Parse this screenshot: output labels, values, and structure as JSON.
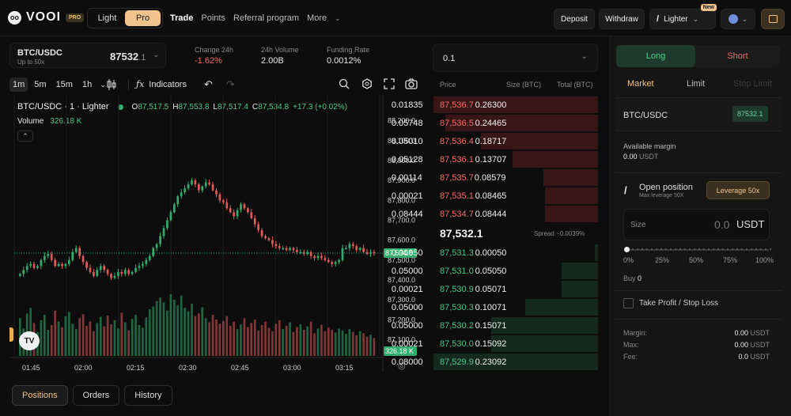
{
  "app": {
    "logo_text": "VOOI",
    "pro_badge": "PRO",
    "mode": {
      "light": "Light",
      "pro": "Pro"
    },
    "nav": [
      "Trade",
      "Points",
      "Referral program",
      "More"
    ],
    "deposit": "Deposit",
    "withdraw": "Withdraw",
    "network": "Lighter",
    "new_badge": "New"
  },
  "market": {
    "pair": "BTC/USDC",
    "leverage": "Up to 50x",
    "price_main": "87532",
    "price_decimal": ".1",
    "change_label": "Change 24h",
    "change_value": "-1.62%",
    "volume_label": "24h Volume",
    "volume_value": "2.00B",
    "funding_label": "Funding Rate",
    "funding_value": "0.0012%"
  },
  "chart_toolbar": {
    "intervals": [
      "1m",
      "5m",
      "15m",
      "1h"
    ],
    "indicators": "Indicators"
  },
  "chart_legend": {
    "title": "BTC/USDC · 1 · Lighter",
    "o_label": "O",
    "o": "87,517.5",
    "h_label": "H",
    "h": "87,553.8",
    "l_label": "L",
    "l": "87,517.4",
    "c_label": "C",
    "c": "87,534.8",
    "chg": "+17.3 (+0.02%)",
    "volume_label": "Volume",
    "volume_value": "326.18 K"
  },
  "chart_data": {
    "type": "candlestick",
    "y_ticks": [
      "88,200.0",
      "88,100.0",
      "88,000.0",
      "87,900.0",
      "87,800.0",
      "87,700.0",
      "87,600.0",
      "87,500.0",
      "87,400.0",
      "87,300.0",
      "87,200.0",
      "87,100.0"
    ],
    "y_ticks_vol_overlap": "87,500.0",
    "x_ticks": [
      "01:45",
      "02:00",
      "02:15",
      "02:30",
      "02:45",
      "03:00",
      "03:15"
    ],
    "ylim": [
      87050,
      88250
    ],
    "last_price_label": "87,534.8",
    "last_volume_label": "326.18 K",
    "close": [
      87430,
      87450,
      87470,
      87480,
      87460,
      87470,
      87500,
      87520,
      87530,
      87500,
      87470,
      87480,
      87470,
      87480,
      87500,
      87540,
      87560,
      87520,
      87490,
      87460,
      87440,
      87420,
      87450,
      87470,
      87450,
      87430,
      87410,
      87420,
      87440,
      87430,
      87450,
      87430,
      87440,
      87460,
      87470,
      87480,
      87500,
      87520,
      87560,
      87580,
      87620,
      87660,
      87700,
      87740,
      87780,
      87820,
      87840,
      87860,
      87880,
      87900,
      87880,
      87850,
      87870,
      87890,
      87880,
      87850,
      87830,
      87800,
      87790,
      87760,
      87740,
      87720,
      87750,
      87780,
      87760,
      87740,
      87710,
      87680,
      87650,
      87620,
      87610,
      87600,
      87580,
      87570,
      87560,
      87560,
      87550,
      87560,
      87550,
      87540,
      87540,
      87530,
      87540,
      87520,
      87510,
      87520,
      87510,
      87500,
      87490,
      87480,
      87490,
      87500,
      87560,
      87560,
      87580,
      87570,
      87550,
      87560,
      87540,
      87530,
      87540,
      87534.8
    ],
    "volume": [
      55,
      40,
      62,
      70,
      48,
      35,
      52,
      60,
      38,
      45,
      66,
      50,
      42,
      58,
      64,
      47,
      39,
      55,
      61,
      44,
      50,
      36,
      48,
      57,
      43,
      59,
      46,
      52,
      40,
      63,
      49,
      37,
      54,
      60,
      45,
      41,
      56,
      68,
      72,
      80,
      85,
      78,
      66,
      90,
      82,
      74,
      88,
      70,
      65,
      76,
      58,
      62,
      71,
      55,
      49,
      60,
      53,
      47,
      51,
      58,
      44,
      50,
      39,
      46,
      55,
      42,
      48,
      53,
      37,
      45,
      50,
      41,
      36,
      47,
      52,
      39,
      44,
      49,
      35,
      42,
      46,
      38,
      43,
      50,
      33,
      40,
      45,
      36,
      41,
      38,
      34,
      40,
      37,
      32,
      39,
      35,
      30,
      36,
      33,
      28,
      31,
      26
    ]
  },
  "orderbook": {
    "depth_select": "0.1",
    "headers": [
      "Price",
      "Size (BTC)",
      "Total (BTC)"
    ],
    "asks": [
      {
        "price": "87,536.7",
        "size": "0.01835",
        "total": "0.26300",
        "depth": 1.0
      },
      {
        "price": "87,536.5",
        "size": "0.05748",
        "total": "0.24465",
        "depth": 0.93
      },
      {
        "price": "87,536.4",
        "size": "0.05010",
        "total": "0.18717",
        "depth": 0.71
      },
      {
        "price": "87,536.1",
        "size": "0.05128",
        "total": "0.13707",
        "depth": 0.52
      },
      {
        "price": "87,535.7",
        "size": "0.00114",
        "total": "0.08579",
        "depth": 0.33
      },
      {
        "price": "87,535.1",
        "size": "0.00021",
        "total": "0.08465",
        "depth": 0.32
      },
      {
        "price": "87,534.7",
        "size": "0.08444",
        "total": "0.08444",
        "depth": 0.32
      }
    ],
    "mid_price": "87,532.1",
    "spread": "Spread ~0.0039%",
    "bids": [
      {
        "price": "87,531.3",
        "size": "0.00050",
        "total": "0.00050",
        "depth": 0.02
      },
      {
        "price": "87,531.0",
        "size": "0.05000",
        "total": "0.05050",
        "depth": 0.22
      },
      {
        "price": "87,530.9",
        "size": "0.00021",
        "total": "0.05071",
        "depth": 0.22
      },
      {
        "price": "87,530.3",
        "size": "0.05000",
        "total": "0.10071",
        "depth": 0.44
      },
      {
        "price": "87,530.2",
        "size": "0.05000",
        "total": "0.15071",
        "depth": 0.65
      },
      {
        "price": "87,530.0",
        "size": "0.00021",
        "total": "0.15092",
        "depth": 0.65
      },
      {
        "price": "87,529.9",
        "size": "0.08000",
        "total": "0.23092",
        "depth": 1.0
      }
    ]
  },
  "order_form": {
    "long": "Long",
    "short": "Short",
    "types": [
      "Market",
      "Limit",
      "Stop Limit"
    ],
    "pair": "BTC/USDC",
    "pair_price": "87532.1",
    "avail_label": "Available margin",
    "avail_value": "0.00",
    "avail_unit": "USDT",
    "open_position": "Open position",
    "max_leverage": "Max leverage 50X",
    "leverage_btn": "Leverage 50x",
    "size_label": "Size",
    "size_value": "0.0",
    "size_unit": "USDT",
    "slider_labels": [
      "0%",
      "25%",
      "50%",
      "75%",
      "100%"
    ],
    "buy_label": "Buy",
    "buy_value": "0",
    "tpsl": "Take Profit / Stop Loss",
    "summary": [
      {
        "label": "Margin:",
        "value": "0.00",
        "unit": "USDT"
      },
      {
        "label": "Max:",
        "value": "0.00",
        "unit": "USDT"
      },
      {
        "label": "Fee:",
        "value": "0.0",
        "unit": "USDT"
      }
    ]
  },
  "bottom_tabs": [
    "Positions",
    "Orders",
    "History"
  ]
}
